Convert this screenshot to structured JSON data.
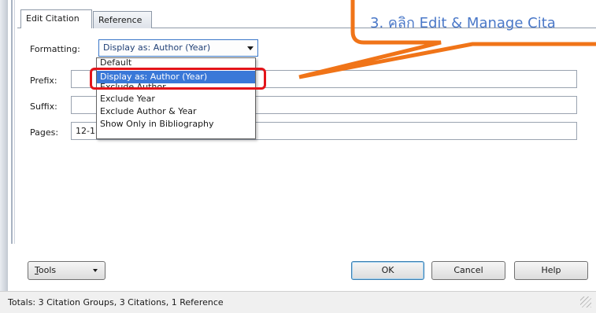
{
  "tabs": [
    {
      "label": "Edit Citation",
      "active": true
    },
    {
      "label": "Reference",
      "active": false
    }
  ],
  "form": {
    "formatting_label": "Formatting:",
    "formatting_value": "Display as: Author (Year)",
    "prefix_label": "Prefix:",
    "prefix_value": "",
    "suffix_label": "Suffix:",
    "suffix_value": "",
    "pages_label": "Pages:",
    "pages_value": "12-15"
  },
  "dropdown": {
    "options": [
      "Default",
      "Display as: Author (Year)",
      "Exclude Author",
      "Exclude Year",
      "Exclude Author & Year",
      "Show Only in Bibliography"
    ],
    "selected_index": 1
  },
  "callout": {
    "text": "3. คลิก Edit & Manage Cita",
    "color": "#f07418",
    "text_color": "#4a78c8"
  },
  "buttons": {
    "tools_label_prefix": "T",
    "tools_label_rest": "ools",
    "ok_label": "OK",
    "cancel_label": "Cancel",
    "help_label": "Help"
  },
  "status": {
    "text": "Totals: 3 Citation Groups, 3 Citations, 1 Reference"
  },
  "colors": {
    "selection": "#3a78d8",
    "highlight_ring": "#e3141a"
  },
  "icons": [
    "chevron-down-icon",
    "resize-grip-icon"
  ]
}
